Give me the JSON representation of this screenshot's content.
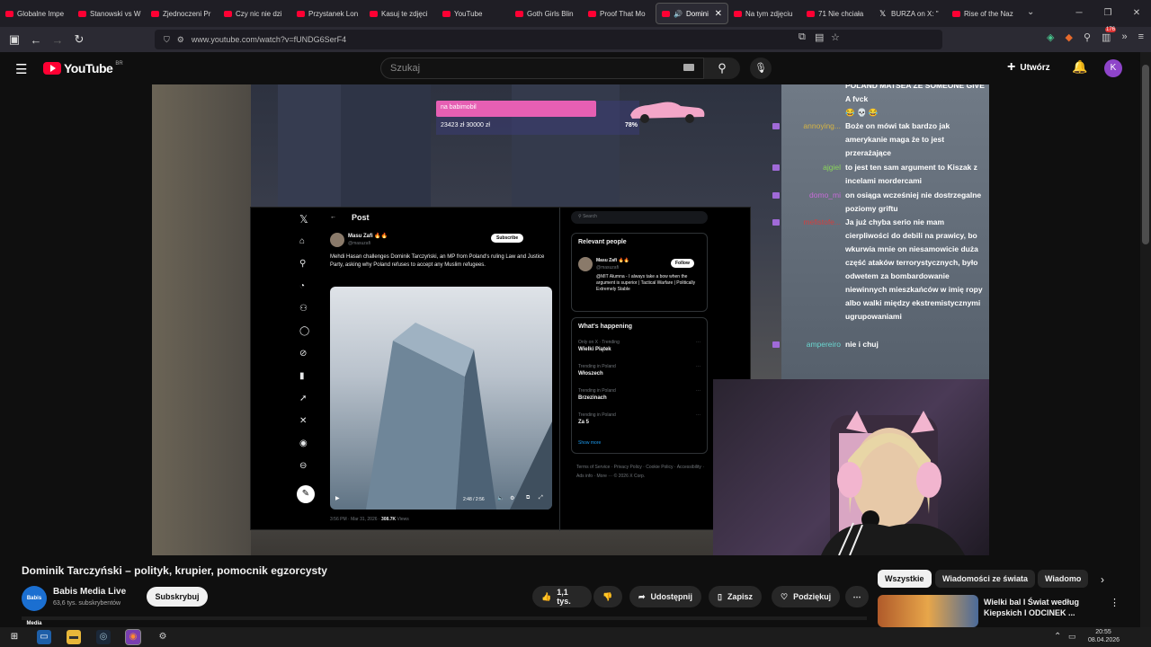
{
  "tabs": [
    {
      "label": "Globalne Impe",
      "icon": "youtube-icon"
    },
    {
      "label": "Stanowski vs W",
      "icon": "youtube-icon"
    },
    {
      "label": "Zjednoczeni Pr",
      "icon": "youtube-icon"
    },
    {
      "label": "Czy nic nie dzi",
      "icon": "youtube-icon"
    },
    {
      "label": "Przystanek Lon",
      "icon": "youtube-icon"
    },
    {
      "label": "Kasuj te zdjęci",
      "icon": "youtube-icon"
    },
    {
      "label": "YouTube",
      "icon": "youtube-icon"
    },
    {
      "label": "Goth Girls Blin",
      "icon": "youtube-icon"
    },
    {
      "label": "Proof That Mo",
      "icon": "youtube-icon"
    },
    {
      "label": "Domini",
      "icon": "youtube-icon",
      "active": true
    },
    {
      "label": "Na tym zdjęciu",
      "icon": "youtube-icon"
    },
    {
      "label": "71 Nie chciała",
      "icon": "youtube-icon"
    },
    {
      "label": "BURZA on X: \"",
      "icon": "x-icon"
    },
    {
      "label": "Rise of the Naz",
      "icon": "youtube-icon"
    }
  ],
  "url": "www.youtube.com/watch?v=fUNDG6SerF4",
  "extension_badge": "176",
  "header": {
    "logo_text": "YouTube",
    "country": "BR",
    "search_placeholder": "Szukaj",
    "create_label": "Utwórz",
    "avatar_letter": "K"
  },
  "stream": {
    "donation_goal": "na babimobil",
    "donation_amount": "23423 zł 30000 zł",
    "donation_pct": "78%",
    "post": {
      "header": "Post",
      "author": "Masu Zafi 🔥🔥",
      "handle": "@masuzafi",
      "subscribe": "Subscribe",
      "text": "Mehdi Hasan challenges Dominik Tarczyński, an MP from Poland's ruling Law and Justice Party, asking why Poland refuses to accept any Muslim refugees.",
      "video_time": "2:48 / 2:56",
      "meta": "3:56 PM · Mar 31, 2026 · ",
      "views": "308.7K",
      "views_label": "Views",
      "search": "Search",
      "relevant_title": "Relevant people",
      "rel_name": "Masu Zafi 🔥🔥",
      "rel_handle": "@masuzafi",
      "follow": "Follow",
      "rel_bio": "@MIT Alumna - I always take a bow when the argument is superior | Tactical Warfare | Politically Extremely Stable",
      "happening_title": "What's happening",
      "trends": [
        {
          "cat": "Only on X · Trending",
          "name": "Wielki Piątek"
        },
        {
          "cat": "Trending in Poland",
          "name": "Włoszech"
        },
        {
          "cat": "Trending in Poland",
          "name": "Brzezinach"
        },
        {
          "cat": "Trending in Poland",
          "name": "Za 5"
        }
      ],
      "show_more": "Show more",
      "footer": "Terms of Service · Privacy Policy · Cookie Policy · Accessibility · Ads info · More ··· © 2026 X Corp."
    },
    "chat": [
      {
        "user": "",
        "msg": "POLAND MATSEA ZE SOMEONE GIVE A fvck",
        "color": "#ffffff"
      },
      {
        "user": "",
        "msg": "😂 💀 😂",
        "color": "#ffffff"
      },
      {
        "user": "annoying...",
        "msg": "Boże on mówi tak bardzo jak amerykanie maga że to jest przerażające",
        "color": "#d6b443"
      },
      {
        "user": "ajgiel",
        "msg": "to jest ten sam argument to Kiszak z incelami mordercami",
        "color": "#8ad65a"
      },
      {
        "user": "domo_mi",
        "msg": "on osiąga wcześniej nie dostrzegalne poziomy griftu",
        "color": "#c76bd8"
      },
      {
        "user": "mefistofe...",
        "msg": "Ja już chyba serio nie mam cierpliwości do debili na prawicy, bo wkurwia mnie on niesamowicie duża część ataków terrorystycznych, było odwetem za bombardowanie niewinnych mieszkańców w imię ropy albo walki między ekstremistycznymi ugrupowaniami",
        "color": "#d04040"
      },
      {
        "user": "ampereiro",
        "msg": "nie i chuj",
        "color": "#6ad6d0"
      }
    ]
  },
  "video": {
    "title": "Dominik Tarczyński – polityk, krupier, pomocnik egzorcysty",
    "channel": "Babis Media Live",
    "channel_avatar": "Babis Media",
    "subscribers": "63,6 tys. subskrybentów",
    "subscribe_label": "Subskrybuj",
    "likes": "1,1 tys.",
    "share": "Udostępnij",
    "save": "Zapisz",
    "thanks": "Podziękuj"
  },
  "related": {
    "chips": [
      "Wszystkie",
      "Wiadomości ze świata",
      "Wiadomo"
    ],
    "first_title": "Wielki bal I Świat według Kiepskich I ODCINEK ..."
  },
  "taskbar": {
    "time": "20:55",
    "date": "08.04.2026"
  }
}
